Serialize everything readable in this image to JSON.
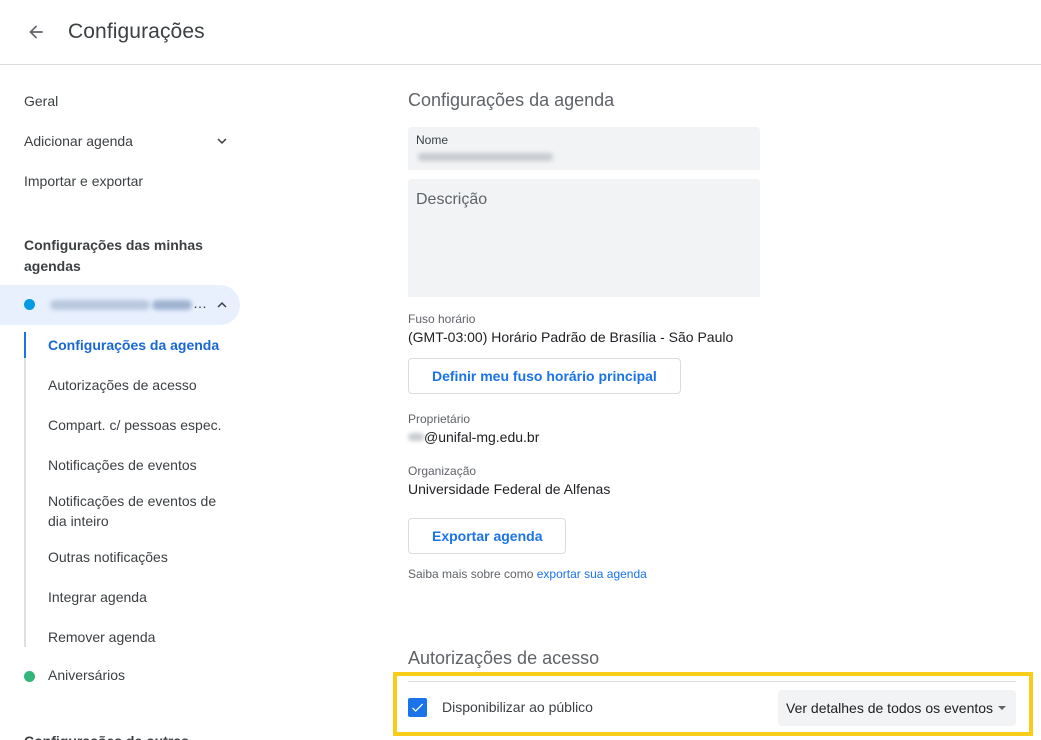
{
  "header": {
    "title": "Configurações"
  },
  "sidebar": {
    "items": [
      {
        "label": "Geral"
      },
      {
        "label": "Adicionar agenda"
      },
      {
        "label": "Importar e exportar"
      }
    ],
    "my_calendars_heading": "Configurações das minhas agendas",
    "my_calendar": {
      "name": "",
      "color": "#039be5"
    },
    "sub_items": [
      {
        "label": "Configurações da agenda"
      },
      {
        "label": "Autorizações de acesso"
      },
      {
        "label": "Compart. c/ pessoas espec."
      },
      {
        "label": "Notificações de eventos"
      },
      {
        "label": "Notificações de eventos de dia inteiro"
      },
      {
        "label": "Outras notificações"
      },
      {
        "label": "Integrar agenda"
      },
      {
        "label": "Remover agenda"
      }
    ],
    "birthdays": {
      "label": "Aniversários",
      "color": "#33b679"
    },
    "other_calendars_heading": "Configurações de outras"
  },
  "main": {
    "calendar_settings_title": "Configurações da agenda",
    "name_field": {
      "label": "Nome",
      "value": ""
    },
    "description_field": {
      "placeholder": "Descrição"
    },
    "timezone": {
      "label": "Fuso horário",
      "value": "(GMT-03:00) Horário Padrão de Brasília - São Paulo",
      "button": "Definir meu fuso horário principal"
    },
    "owner": {
      "label": "Proprietário",
      "value": "@unifal-mg.edu.br"
    },
    "organization": {
      "label": "Organização",
      "value": "Universidade Federal de Alfenas"
    },
    "export_button": "Exportar agenda",
    "export_hint": {
      "prefix": "Saiba mais sobre como ",
      "link": "exportar sua agenda"
    },
    "access_title": "Autorizações de acesso",
    "public_checkbox": {
      "label": "Disponibilizar ao público",
      "checked": true
    },
    "public_select": {
      "value": "Ver detalhes de todos os eventos"
    }
  },
  "colors": {
    "accent": "#1a73e8",
    "highlight": "#f8cc1b"
  }
}
